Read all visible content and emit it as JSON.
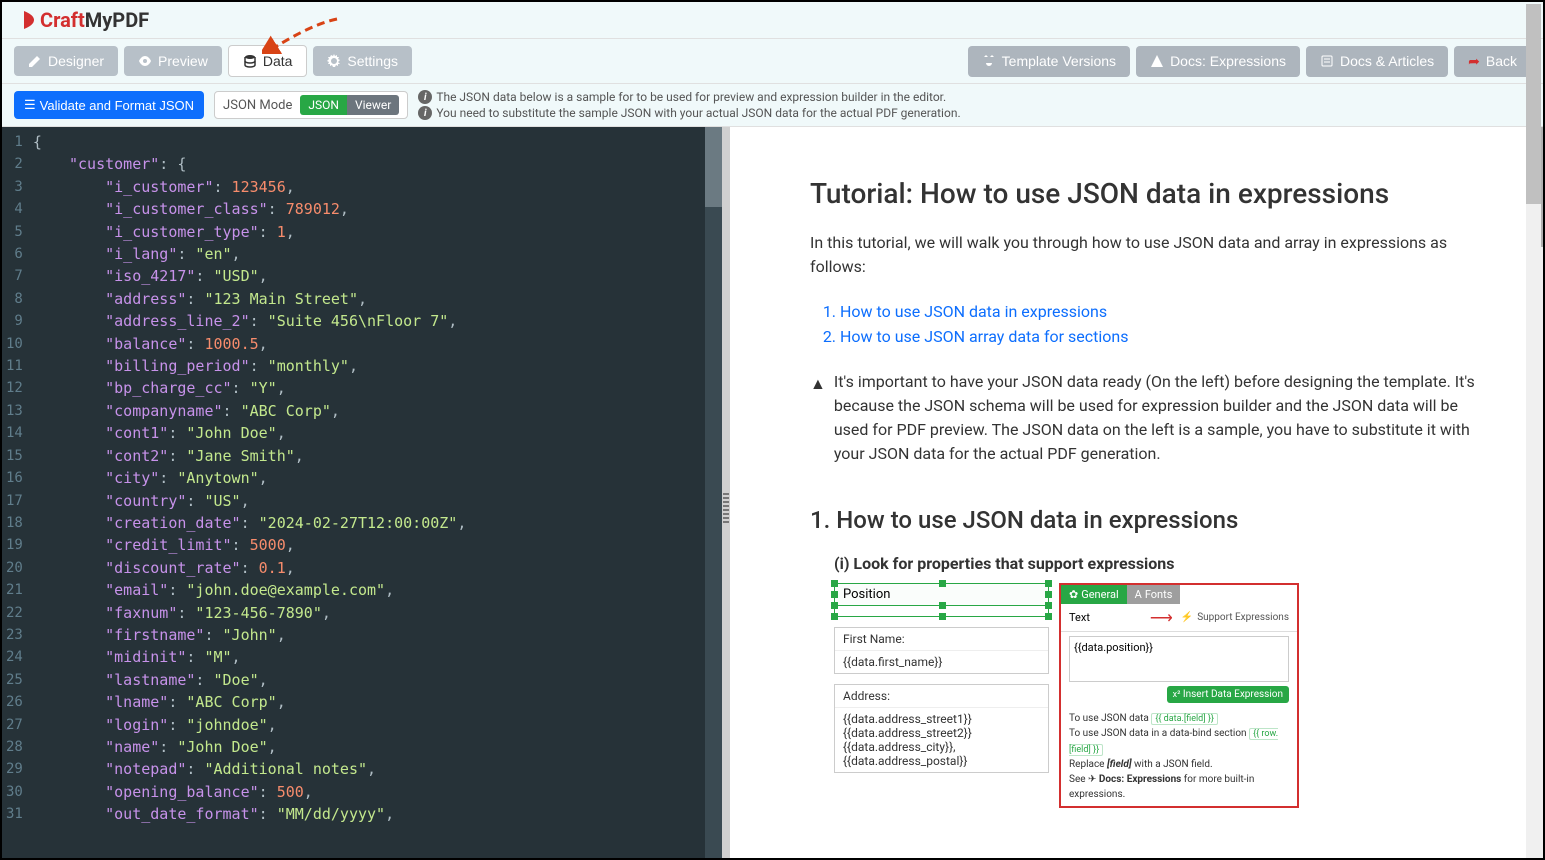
{
  "logo": {
    "craft": "Craft",
    "rest": "MyPDF"
  },
  "tabs": {
    "designer": "Designer",
    "preview": "Preview",
    "data": "Data",
    "settings": "Settings"
  },
  "toolbar_right": {
    "versions": "Template Versions",
    "expressions": "Docs: Expressions",
    "articles": "Docs & Articles",
    "back": "Back"
  },
  "subbar": {
    "validate": "Validate and Format JSON",
    "mode_label": "JSON Mode",
    "toggle_json": "JSON",
    "toggle_viewer": "Viewer",
    "info1": "The JSON data below is a sample for to be used for preview and expression builder in the editor.",
    "info2": "You need to substitute the sample JSON with your actual JSON data for the actual PDF generation."
  },
  "json_lines": [
    [
      [
        "p",
        "{"
      ]
    ],
    [
      [
        "p",
        "    "
      ],
      [
        "k",
        "\"customer\""
      ],
      [
        "p",
        ": {"
      ]
    ],
    [
      [
        "p",
        "        "
      ],
      [
        "k",
        "\"i_customer\""
      ],
      [
        "p",
        ": "
      ],
      [
        "n",
        "123456"
      ],
      [
        "p",
        ","
      ]
    ],
    [
      [
        "p",
        "        "
      ],
      [
        "k",
        "\"i_customer_class\""
      ],
      [
        "p",
        ": "
      ],
      [
        "n",
        "789012"
      ],
      [
        "p",
        ","
      ]
    ],
    [
      [
        "p",
        "        "
      ],
      [
        "k",
        "\"i_customer_type\""
      ],
      [
        "p",
        ": "
      ],
      [
        "n",
        "1"
      ],
      [
        "p",
        ","
      ]
    ],
    [
      [
        "p",
        "        "
      ],
      [
        "k",
        "\"i_lang\""
      ],
      [
        "p",
        ": "
      ],
      [
        "s",
        "\"en\""
      ],
      [
        "p",
        ","
      ]
    ],
    [
      [
        "p",
        "        "
      ],
      [
        "k",
        "\"iso_4217\""
      ],
      [
        "p",
        ": "
      ],
      [
        "s",
        "\"USD\""
      ],
      [
        "p",
        ","
      ]
    ],
    [
      [
        "p",
        "        "
      ],
      [
        "k",
        "\"address\""
      ],
      [
        "p",
        ": "
      ],
      [
        "s",
        "\"123 Main Street\""
      ],
      [
        "p",
        ","
      ]
    ],
    [
      [
        "p",
        "        "
      ],
      [
        "k",
        "\"address_line_2\""
      ],
      [
        "p",
        ": "
      ],
      [
        "s",
        "\"Suite 456\\nFloor 7\""
      ],
      [
        "p",
        ","
      ]
    ],
    [
      [
        "p",
        "        "
      ],
      [
        "k",
        "\"balance\""
      ],
      [
        "p",
        ": "
      ],
      [
        "n",
        "1000.5"
      ],
      [
        "p",
        ","
      ]
    ],
    [
      [
        "p",
        "        "
      ],
      [
        "k",
        "\"billing_period\""
      ],
      [
        "p",
        ": "
      ],
      [
        "s",
        "\"monthly\""
      ],
      [
        "p",
        ","
      ]
    ],
    [
      [
        "p",
        "        "
      ],
      [
        "k",
        "\"bp_charge_cc\""
      ],
      [
        "p",
        ": "
      ],
      [
        "s",
        "\"Y\""
      ],
      [
        "p",
        ","
      ]
    ],
    [
      [
        "p",
        "        "
      ],
      [
        "k",
        "\"companyname\""
      ],
      [
        "p",
        ": "
      ],
      [
        "s",
        "\"ABC Corp\""
      ],
      [
        "p",
        ","
      ]
    ],
    [
      [
        "p",
        "        "
      ],
      [
        "k",
        "\"cont1\""
      ],
      [
        "p",
        ": "
      ],
      [
        "s",
        "\"John Doe\""
      ],
      [
        "p",
        ","
      ]
    ],
    [
      [
        "p",
        "        "
      ],
      [
        "k",
        "\"cont2\""
      ],
      [
        "p",
        ": "
      ],
      [
        "s",
        "\"Jane Smith\""
      ],
      [
        "p",
        ","
      ]
    ],
    [
      [
        "p",
        "        "
      ],
      [
        "k",
        "\"city\""
      ],
      [
        "p",
        ": "
      ],
      [
        "s",
        "\"Anytown\""
      ],
      [
        "p",
        ","
      ]
    ],
    [
      [
        "p",
        "        "
      ],
      [
        "k",
        "\"country\""
      ],
      [
        "p",
        ": "
      ],
      [
        "s",
        "\"US\""
      ],
      [
        "p",
        ","
      ]
    ],
    [
      [
        "p",
        "        "
      ],
      [
        "k",
        "\"creation_date\""
      ],
      [
        "p",
        ": "
      ],
      [
        "s",
        "\"2024-02-27T12:00:00Z\""
      ],
      [
        "p",
        ","
      ]
    ],
    [
      [
        "p",
        "        "
      ],
      [
        "k",
        "\"credit_limit\""
      ],
      [
        "p",
        ": "
      ],
      [
        "n",
        "5000"
      ],
      [
        "p",
        ","
      ]
    ],
    [
      [
        "p",
        "        "
      ],
      [
        "k",
        "\"discount_rate\""
      ],
      [
        "p",
        ": "
      ],
      [
        "n",
        "0.1"
      ],
      [
        "p",
        ","
      ]
    ],
    [
      [
        "p",
        "        "
      ],
      [
        "k",
        "\"email\""
      ],
      [
        "p",
        ": "
      ],
      [
        "s",
        "\"john.doe@example.com\""
      ],
      [
        "p",
        ","
      ]
    ],
    [
      [
        "p",
        "        "
      ],
      [
        "k",
        "\"faxnum\""
      ],
      [
        "p",
        ": "
      ],
      [
        "s",
        "\"123-456-7890\""
      ],
      [
        "p",
        ","
      ]
    ],
    [
      [
        "p",
        "        "
      ],
      [
        "k",
        "\"firstname\""
      ],
      [
        "p",
        ": "
      ],
      [
        "s",
        "\"John\""
      ],
      [
        "p",
        ","
      ]
    ],
    [
      [
        "p",
        "        "
      ],
      [
        "k",
        "\"midinit\""
      ],
      [
        "p",
        ": "
      ],
      [
        "s",
        "\"M\""
      ],
      [
        "p",
        ","
      ]
    ],
    [
      [
        "p",
        "        "
      ],
      [
        "k",
        "\"lastname\""
      ],
      [
        "p",
        ": "
      ],
      [
        "s",
        "\"Doe\""
      ],
      [
        "p",
        ","
      ]
    ],
    [
      [
        "p",
        "        "
      ],
      [
        "k",
        "\"lname\""
      ],
      [
        "p",
        ": "
      ],
      [
        "s",
        "\"ABC Corp\""
      ],
      [
        "p",
        ","
      ]
    ],
    [
      [
        "p",
        "        "
      ],
      [
        "k",
        "\"login\""
      ],
      [
        "p",
        ": "
      ],
      [
        "s",
        "\"johndoe\""
      ],
      [
        "p",
        ","
      ]
    ],
    [
      [
        "p",
        "        "
      ],
      [
        "k",
        "\"name\""
      ],
      [
        "p",
        ": "
      ],
      [
        "s",
        "\"John Doe\""
      ],
      [
        "p",
        ","
      ]
    ],
    [
      [
        "p",
        "        "
      ],
      [
        "k",
        "\"notepad\""
      ],
      [
        "p",
        ": "
      ],
      [
        "s",
        "\"Additional notes\""
      ],
      [
        "p",
        ","
      ]
    ],
    [
      [
        "p",
        "        "
      ],
      [
        "k",
        "\"opening_balance\""
      ],
      [
        "p",
        ": "
      ],
      [
        "n",
        "500"
      ],
      [
        "p",
        ","
      ]
    ],
    [
      [
        "p",
        "        "
      ],
      [
        "k",
        "\"out_date_format\""
      ],
      [
        "p",
        ": "
      ],
      [
        "s",
        "\"MM/dd/yyyy\""
      ],
      [
        "p",
        ","
      ]
    ]
  ],
  "preview": {
    "title": "Tutorial: How to use JSON data in expressions",
    "intro": "In this tutorial, we will walk you through how to use JSON data and array in expressions as follows:",
    "link1": "How to use JSON data in expressions",
    "link2": "How to use JSON array data for sections",
    "warning": "It's important to have your JSON data ready (On the left) before designing the template. It's because the JSON schema will be used for expression builder and the JSON data will be used for PDF preview. The JSON data on the left is a sample, you have to substitute it with your JSON data for the actual PDF generation.",
    "h2": "1. How to use JSON data in expressions",
    "h3": "(i) Look for properties that support expressions",
    "mockup": {
      "position_label": "Position",
      "position_value": "{{data.position}}",
      "firstname_label": "First Name:",
      "firstname_value": "{{data.first_name}}",
      "address_label": "Address:",
      "address_v1": "{{data.address_street1}}",
      "address_v2": "{{data.address_street2}}",
      "address_v3": "{{data.address_city}}, {{data.address_postal}}",
      "tab_general": "General",
      "tab_fonts": "Fonts",
      "text_label": "Text",
      "support_label": "Support Expressions",
      "textarea": "{{data.position}}",
      "insert_btn": "Insert Data Expression",
      "note1_pre": "To use JSON data ",
      "note1_chip": "{{ data.[field] }}",
      "note2_pre": "To use JSON data in a data-bind section ",
      "note2_chip": "{{ row.[field] }}",
      "note3_pre": "Replace ",
      "note3_it": "[field]",
      "note3_post": " with a JSON field.",
      "note4_pre": "See ",
      "note4_b": "Docs: Expressions",
      "note4_post": " for more built-in expressions."
    }
  }
}
